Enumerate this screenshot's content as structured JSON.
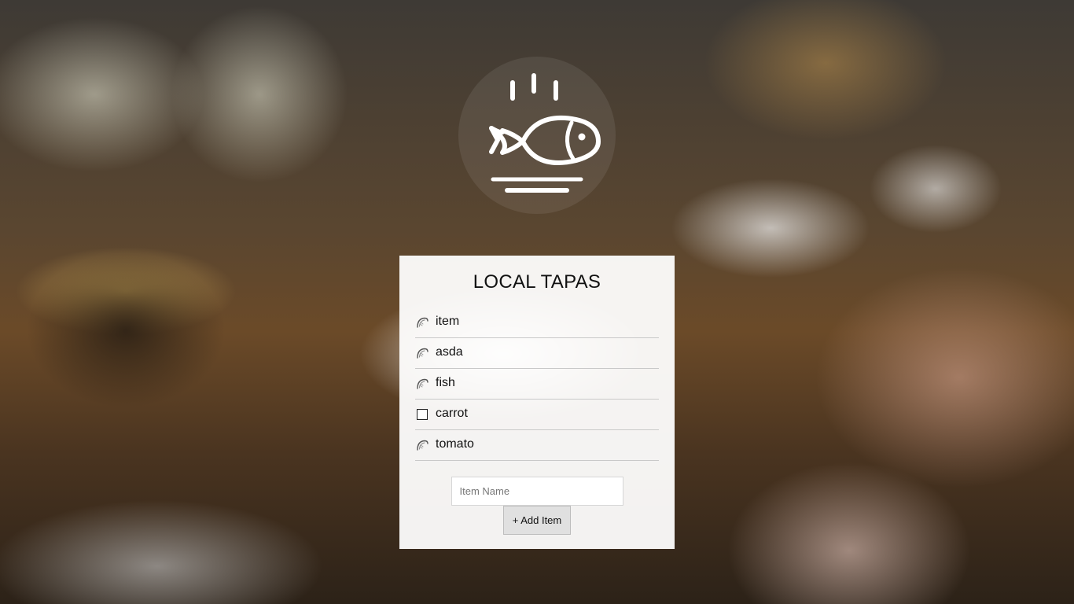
{
  "app": {
    "title": "LOCAL TAPAS",
    "logo_icon": "fish-on-plate-icon"
  },
  "items": [
    {
      "label": "item",
      "icon": "taco-icon",
      "checked": true
    },
    {
      "label": "asda",
      "icon": "taco-icon",
      "checked": true
    },
    {
      "label": "fish",
      "icon": "taco-icon",
      "checked": true
    },
    {
      "label": "carrot",
      "icon": "checkbox-empty-icon",
      "checked": false
    },
    {
      "label": "tomato",
      "icon": "taco-icon",
      "checked": true
    }
  ],
  "form": {
    "input_value": "",
    "input_placeholder": "Item Name",
    "add_button_label": "+ Add Item"
  },
  "colors": {
    "card_background": "#ffffff",
    "button_background": "#e0e0e0",
    "divider": "#c9c9c9"
  }
}
